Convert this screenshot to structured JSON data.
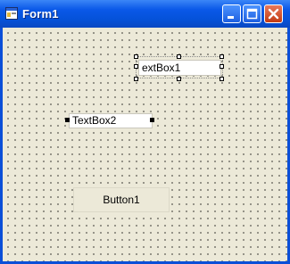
{
  "window": {
    "title": "Form1",
    "icon": "form-icon",
    "controls": [
      "minimize-icon",
      "maximize-icon",
      "close-icon"
    ],
    "colors": {
      "titlebar": "#0552d9",
      "client": "#ece9d8",
      "close": "#c23a12"
    }
  },
  "form": {
    "textbox1": {
      "text": "extBox1",
      "selected": true
    },
    "textbox2": {
      "text": "TextBox2"
    },
    "button1": {
      "label": "Button1"
    }
  }
}
